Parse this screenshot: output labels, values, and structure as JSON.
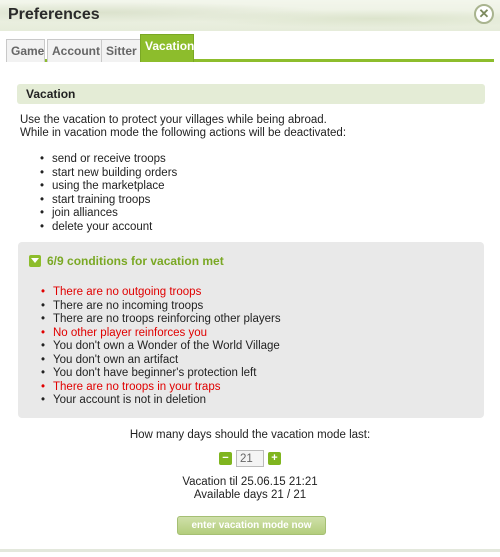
{
  "window": {
    "title": "Preferences",
    "close_icon": "close-icon"
  },
  "tabs": [
    {
      "label": "Game",
      "active": false
    },
    {
      "label": "Account",
      "active": false
    },
    {
      "label": "Sitter",
      "active": false
    },
    {
      "label": "Vacation",
      "active": true
    }
  ],
  "section": {
    "heading": "Vacation"
  },
  "intro": {
    "line1": "Use the vacation to protect your villages while being abroad.",
    "line2": "While in vacation mode the following actions will be deactivated:"
  },
  "deactivated_actions": [
    "send or receive troops",
    "start new building orders",
    "using the marketplace",
    "start training troops",
    "join alliances",
    "delete your account"
  ],
  "conditions": {
    "heading": "6/9 conditions for vacation met",
    "items": [
      {
        "text": "There are no outgoing troops",
        "met": false
      },
      {
        "text": "There are no incoming troops",
        "met": true
      },
      {
        "text": "There are no troops reinforcing other players",
        "met": true
      },
      {
        "text": "No other player reinforces you",
        "met": false
      },
      {
        "text": "You don't own a Wonder of the World Village",
        "met": true
      },
      {
        "text": "You don't own an artifact",
        "met": true
      },
      {
        "text": "You don't have beginner's protection left",
        "met": true
      },
      {
        "text": "There are no troops in your traps",
        "met": false
      },
      {
        "text": "Your account is not in deletion",
        "met": true
      }
    ]
  },
  "duration": {
    "question": "How many days should the vacation mode last:",
    "value": "21",
    "minus_label": "−",
    "plus_label": "+",
    "vacation_til": "Vacation til 25.06.15 21:21",
    "available_days": "Available days 21 / 21"
  },
  "enter_button": {
    "label": "enter vacation mode now"
  },
  "colors": {
    "accent": "#8dbd2c",
    "fail": "#e00000",
    "condition_heading": "#7aa824"
  }
}
